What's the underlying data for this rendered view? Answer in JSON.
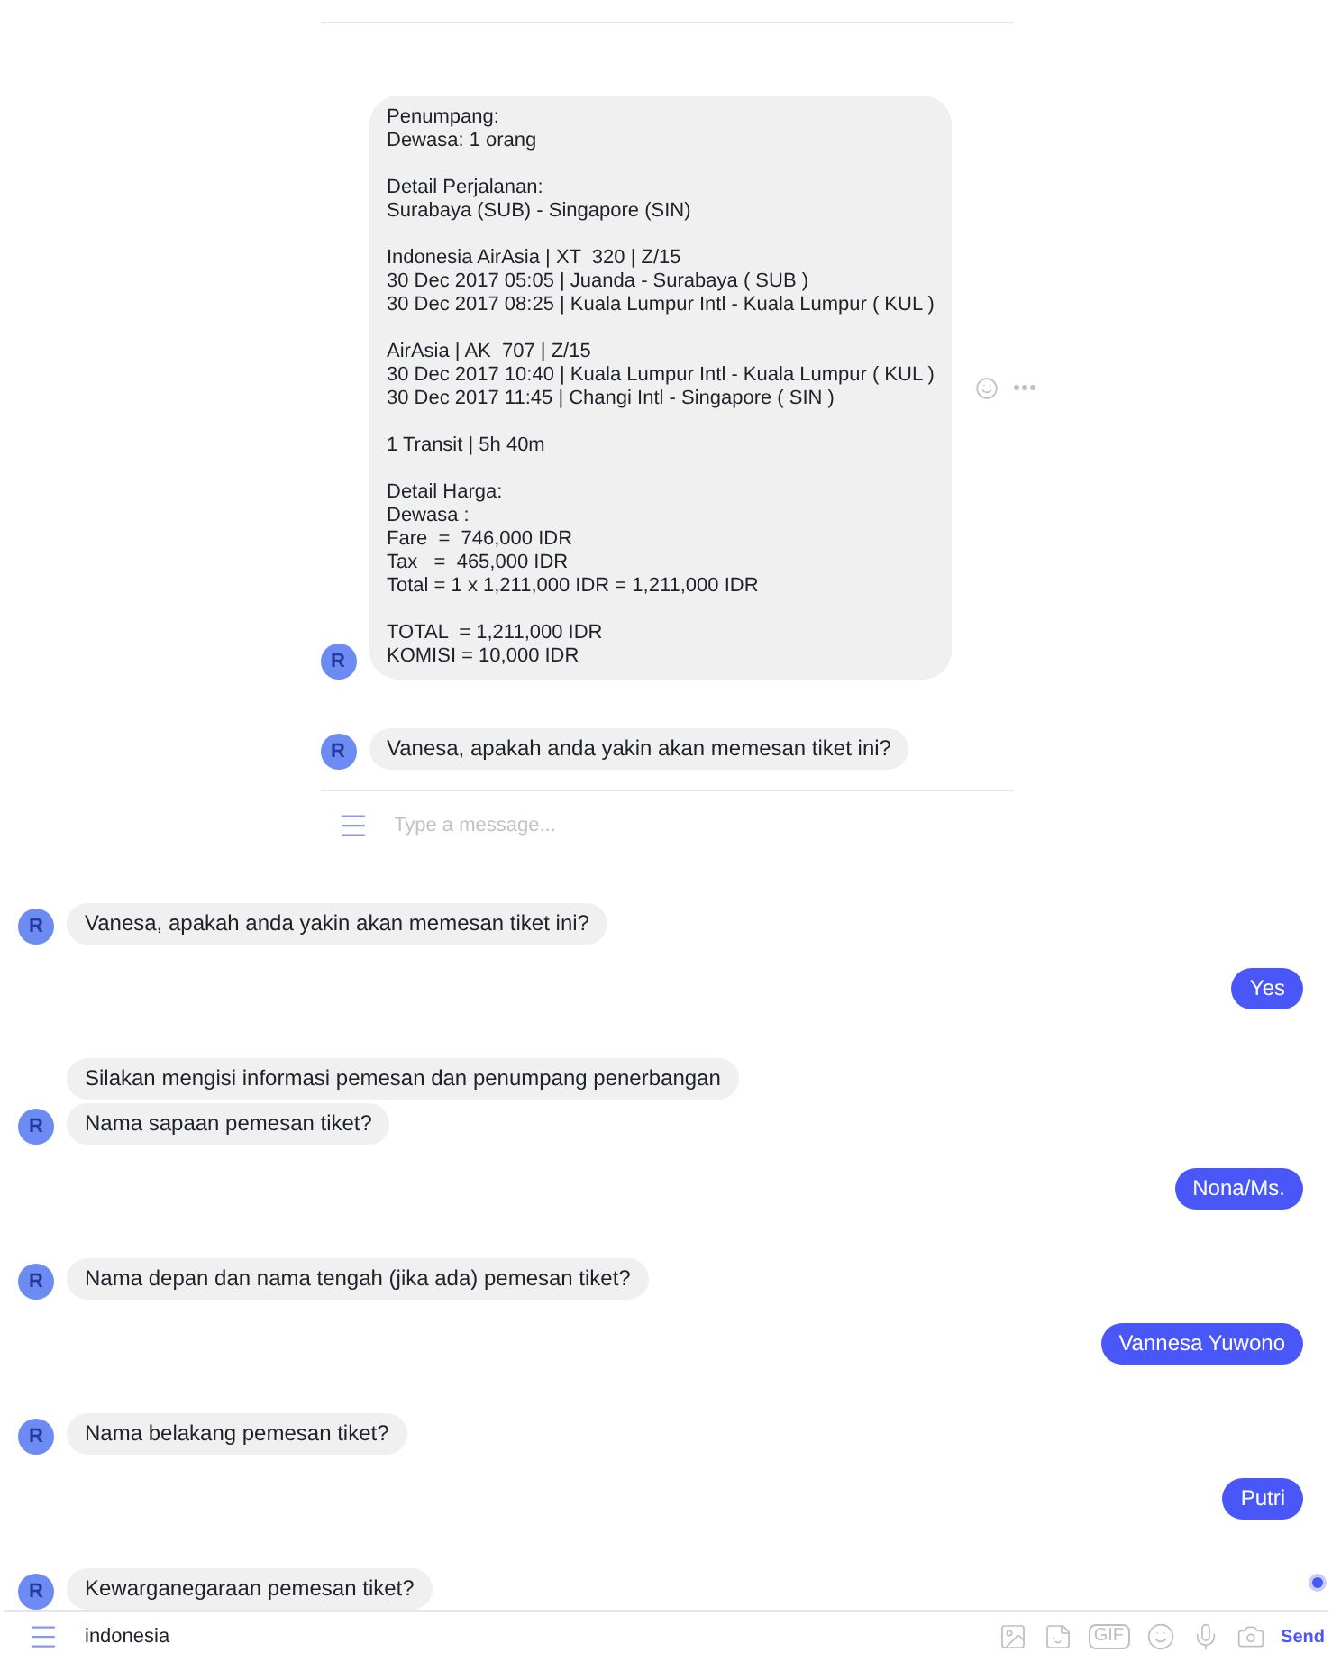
{
  "embedded_chat": {
    "messages": [
      {
        "kind": "incoming",
        "avatar": "R",
        "text": "Penumpang:\nDewasa: 1 orang\n\nDetail Perjalanan:\nSurabaya (SUB) - Singapore (SIN)\n\nIndonesia AirAsia | XT  320 | Z/15\n30 Dec 2017 05:05 | Juanda - Surabaya ( SUB )\n30 Dec 2017 08:25 | Kuala Lumpur Intl - Kuala Lumpur ( KUL )\n\nAirAsia | AK  707 | Z/15\n30 Dec 2017 10:40 | Kuala Lumpur Intl - Kuala Lumpur ( KUL )\n30 Dec 2017 11:45 | Changi Intl - Singapore ( SIN )\n\n1 Transit | 5h 40m\n\nDetail Harga:\nDewasa :\nFare  =  746,000 IDR\nTax   =  465,000 IDR\nTotal = 1 x 1,211,000 IDR = 1,211,000 IDR\n\nTOTAL  = 1,211,000 IDR\nKOMISI = 10,000 IDR",
        "actions": true
      },
      {
        "kind": "incoming",
        "avatar": "R",
        "text": "Vanesa, apakah anda yakin akan memesan tiket ini?",
        "actions": false
      }
    ],
    "composer": {
      "placeholder": "Type a message..."
    }
  },
  "messages": [
    {
      "kind": "incoming",
      "avatar": "R",
      "bubbles": [
        "Vanesa, apakah anda yakin akan memesan tiket ini?"
      ]
    },
    {
      "kind": "outgoing",
      "bubbles": [
        "Yes"
      ]
    },
    {
      "kind": "incoming",
      "avatar": "R",
      "bubbles": [
        "Silakan mengisi informasi pemesan dan penumpang penerbangan",
        "Nama sapaan pemesan tiket?"
      ]
    },
    {
      "kind": "outgoing",
      "bubbles": [
        "Nona/Ms."
      ]
    },
    {
      "kind": "incoming",
      "avatar": "R",
      "bubbles": [
        "Nama depan dan nama tengah (jika ada) pemesan tiket?"
      ]
    },
    {
      "kind": "outgoing",
      "bubbles": [
        "Vannesa Yuwono"
      ]
    },
    {
      "kind": "incoming",
      "avatar": "R",
      "bubbles": [
        "Nama belakang pemesan tiket?"
      ]
    },
    {
      "kind": "outgoing",
      "bubbles": [
        "Putri"
      ]
    },
    {
      "kind": "incoming",
      "avatar": "R",
      "bubbles": [
        "Kewarganegaraan pemesan tiket?"
      ]
    }
  ],
  "composer": {
    "value": "indonesia",
    "gif_label": "GIF",
    "send_label": "Send"
  }
}
